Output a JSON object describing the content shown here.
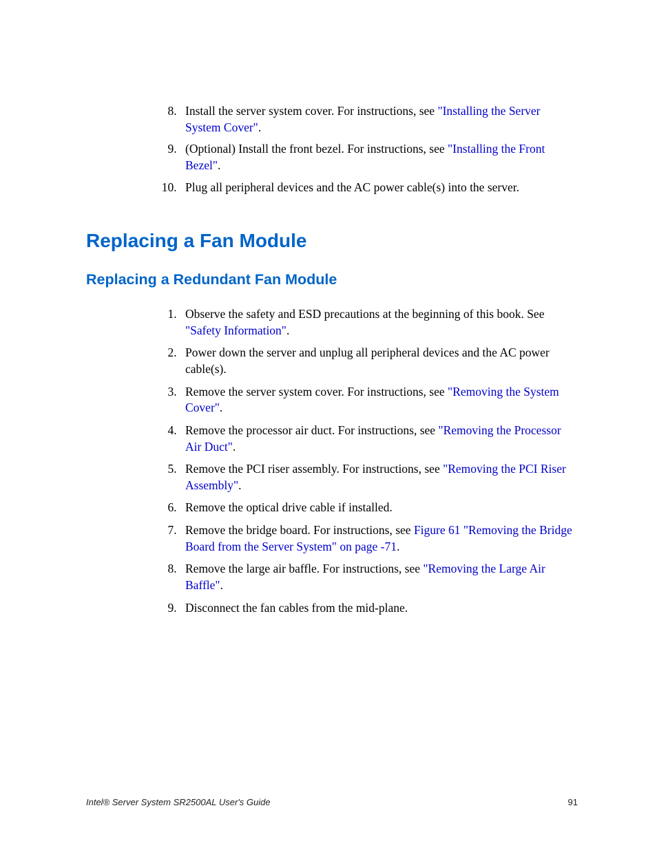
{
  "list1": {
    "start": 8,
    "items": [
      {
        "pre": "Install the server system cover. For instructions, see ",
        "link": "\"Installing the Server System Cover\"",
        "post": "."
      },
      {
        "pre": "(Optional) Install the front bezel. For instructions, see ",
        "link": "\"Installing the Front Bezel\"",
        "post": "."
      },
      {
        "pre": "Plug all peripheral devices and the AC power cable(s) into the server.",
        "link": "",
        "post": ""
      }
    ]
  },
  "h1": "Replacing a Fan Module",
  "h2": "Replacing a Redundant Fan Module",
  "list2": {
    "start": 1,
    "items": [
      {
        "pre": "Observe the safety and ESD precautions at the beginning of this book. See ",
        "link": "\"Safety Information\"",
        "post": "."
      },
      {
        "pre": "Power down the server and unplug all peripheral devices and the AC power cable(s).",
        "link": "",
        "post": ""
      },
      {
        "pre": "Remove the server system cover. For instructions, see ",
        "link": "\"Removing the System Cover\"",
        "post": "."
      },
      {
        "pre": "Remove the processor air duct. For instructions, see ",
        "link": "\"Removing the Processor Air Duct\"",
        "post": "."
      },
      {
        "pre": "Remove the PCI riser assembly. For instructions, see ",
        "link": "\"Removing the PCI Riser Assembly\"",
        "post": "."
      },
      {
        "pre": "Remove the optical drive cable if installed.",
        "link": "",
        "post": ""
      },
      {
        "pre": "Remove the bridge board. For instructions, see ",
        "link": "Figure 61 \"Removing the Bridge Board from the Server System\" on page -71",
        "post": "."
      },
      {
        "pre": "Remove the large air baffle. For instructions, see ",
        "link": "\"Removing the Large Air Baffle\"",
        "post": "."
      },
      {
        "pre": "Disconnect the fan cables from the mid-plane.",
        "link": "",
        "post": ""
      }
    ]
  },
  "footer": {
    "left": "Intel® Server System SR2500AL User's Guide",
    "right": "91"
  }
}
